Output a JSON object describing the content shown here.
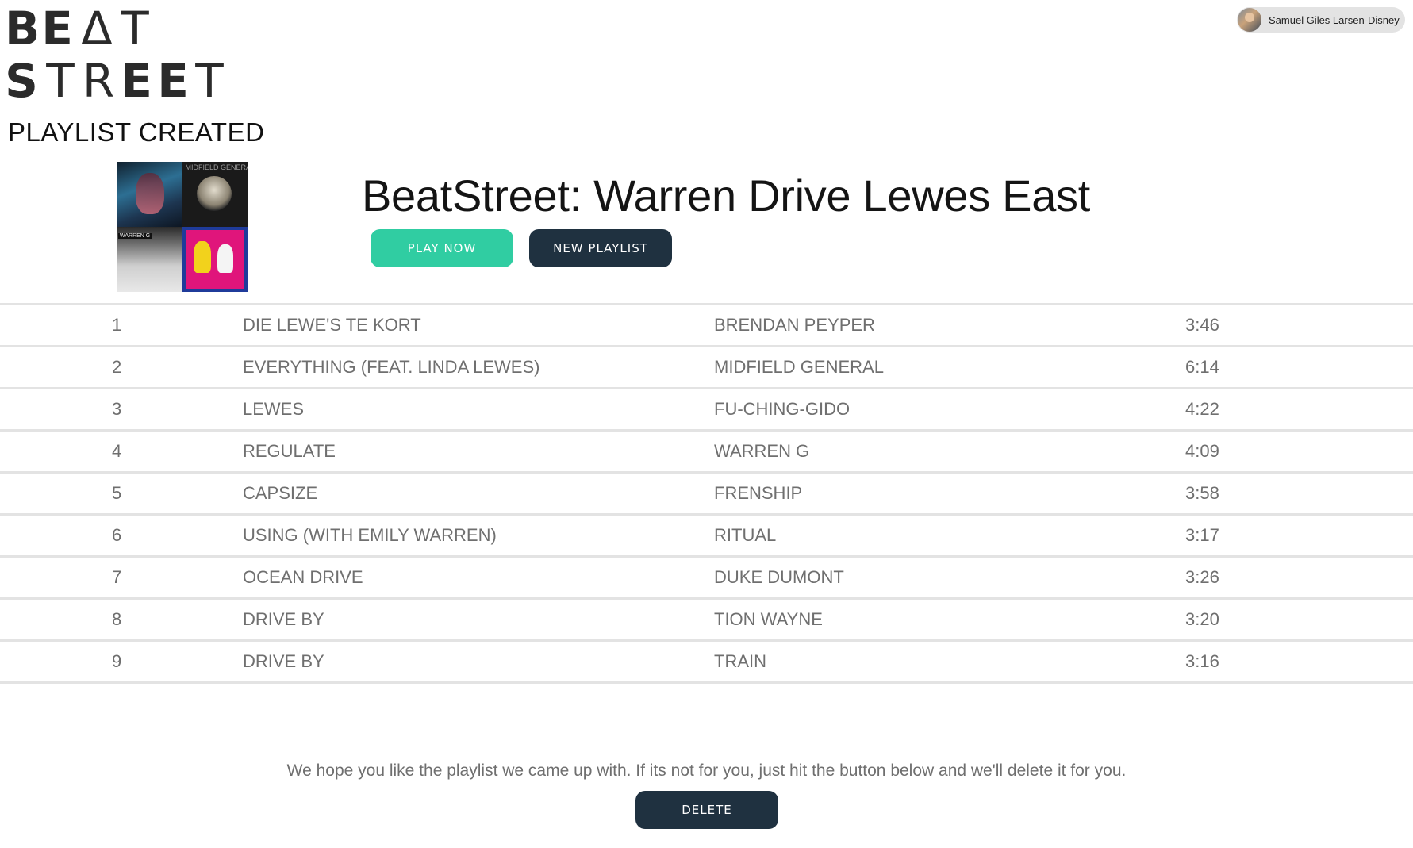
{
  "brand": {
    "logo_line1": [
      "B",
      "E",
      "Δ",
      "T"
    ],
    "logo_line2": [
      "S",
      "T",
      "R",
      "E",
      "E",
      "T"
    ],
    "logo_alt": "BEAT STREET"
  },
  "header": {
    "heading": "PLAYLIST CREATED"
  },
  "user": {
    "name": "Samuel Giles Larsen-Disney"
  },
  "cover": {
    "tile_label_top_right": "MIDFIELD GENERAL",
    "tile_label_bottom_left": "WARREN G"
  },
  "playlist": {
    "title": "BeatStreet: Warren Drive Lewes East",
    "play_label": "PLAY NOW",
    "new_label": "NEW PLAYLIST"
  },
  "tracks": [
    {
      "num": "1",
      "title": "DIE LEWE'S TE KORT",
      "artist": "BRENDAN PEYPER",
      "duration": "3:46"
    },
    {
      "num": "2",
      "title": "EVERYTHING (FEAT. LINDA LEWES)",
      "artist": "MIDFIELD GENERAL",
      "duration": "6:14"
    },
    {
      "num": "3",
      "title": "LEWES",
      "artist": "FU-CHING-GIDO",
      "duration": "4:22"
    },
    {
      "num": "4",
      "title": "REGULATE",
      "artist": "WARREN G",
      "duration": "4:09"
    },
    {
      "num": "5",
      "title": "CAPSIZE",
      "artist": "FRENSHIP",
      "duration": "3:58"
    },
    {
      "num": "6",
      "title": "USING (WITH EMILY WARREN)",
      "artist": "RITUAL",
      "duration": "3:17"
    },
    {
      "num": "7",
      "title": "OCEAN DRIVE",
      "artist": "DUKE DUMONT",
      "duration": "3:26"
    },
    {
      "num": "8",
      "title": "DRIVE BY",
      "artist": "TION WAYNE",
      "duration": "3:20"
    },
    {
      "num": "9",
      "title": "DRIVE BY",
      "artist": "TRAIN",
      "duration": "3:16"
    }
  ],
  "footer": {
    "message": "We hope you like the playlist we came up with. If its not for you, just hit the button below and we'll delete it for you.",
    "delete_label": "DELETE"
  },
  "colors": {
    "accent_play": "#30cda2",
    "dark_button": "#1f3140",
    "row_text": "#6f6f6f",
    "divider": "#e3e3e3"
  }
}
